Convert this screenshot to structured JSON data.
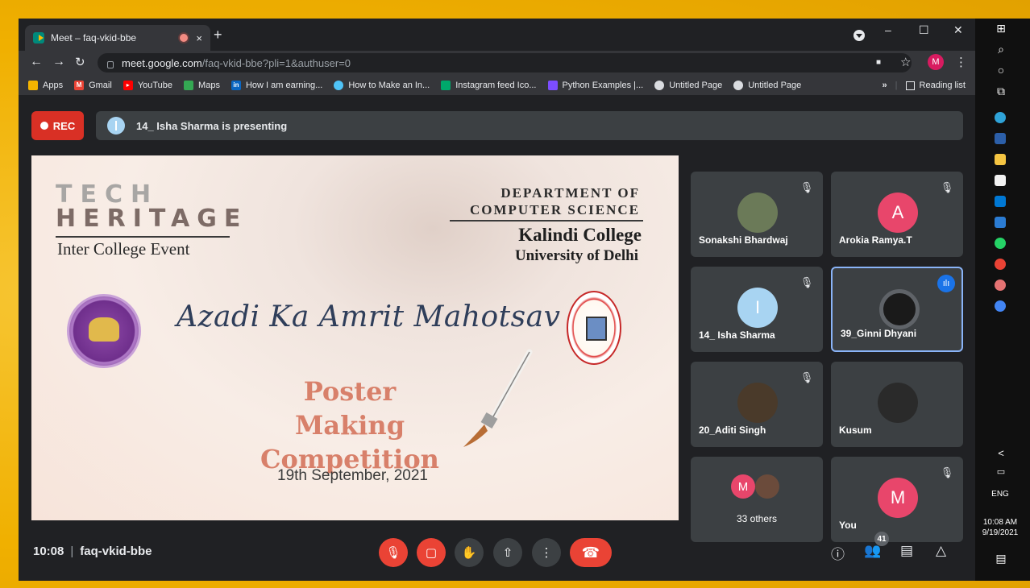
{
  "browser": {
    "tab_title": "Meet – faq-vkid-bbe",
    "tab_close": "×",
    "new_tab": "+",
    "window_controls": [
      "–",
      "☐",
      "✕"
    ],
    "url_host": "meet.google.com",
    "url_path": "/faq-vkid-bbe?pli=1&authuser=0",
    "profile_initial": "M",
    "bookmarks": [
      {
        "label": "Apps",
        "icon": "apps-grid-icon",
        "color": "#f4b400"
      },
      {
        "label": "Gmail",
        "icon": "gmail-icon",
        "color": "#ea4335"
      },
      {
        "label": "YouTube",
        "icon": "youtube-icon",
        "color": "#ff0000"
      },
      {
        "label": "Maps",
        "icon": "maps-icon",
        "color": "#34a853"
      },
      {
        "label": "How I am earning...",
        "icon": "linkedin-icon",
        "color": "#0a66c2"
      },
      {
        "label": "How to Make an In...",
        "icon": "site-icon",
        "color": "#4fc3f7"
      },
      {
        "label": "Instagram feed Ico...",
        "icon": "site-icon",
        "color": "#00a86b"
      },
      {
        "label": "Python Examples |...",
        "icon": "python-icon",
        "color": "#7c4dff"
      },
      {
        "label": "Untitled Page",
        "icon": "globe-icon",
        "color": "#9aa0a6"
      },
      {
        "label": "Untitled Page",
        "icon": "globe-icon",
        "color": "#9aa0a6"
      }
    ],
    "more_bookmarks": "»",
    "reading_list": "Reading list"
  },
  "meet": {
    "rec_label": "REC",
    "presenting_text": "14_ Isha Sharma is presenting",
    "slide": {
      "tech": "TECH",
      "heritage": "HERITAGE",
      "inter": "Inter College Event",
      "dept_line1": "DEPARTMENT OF",
      "dept_line2": "COMPUTER SCIENCE",
      "college": "Kalindi College",
      "university": "University of Delhi",
      "headline": "Azadi Ka Amrit Mahotsav",
      "poster_line1": "Poster Making",
      "poster_line2": "Competition",
      "date": "19th September, 2021"
    },
    "tiles": [
      {
        "name": "Sonakshi Bhardwaj",
        "muted": true,
        "avatar": "photo"
      },
      {
        "name": "Arokia Ramya.T",
        "muted": true,
        "avatar": "A",
        "color": "#e8466b"
      },
      {
        "name": "14_ Isha Sharma",
        "muted": true,
        "avatar": "I",
        "color": "#a8d4f2"
      },
      {
        "name": "39_Ginni Dhyani",
        "muted": false,
        "speaking": true,
        "avatar": "photo"
      },
      {
        "name": "20_Aditi Singh",
        "muted": true,
        "avatar": "photo"
      },
      {
        "name": "Kusum",
        "muted": false,
        "avatar": "photo"
      },
      {
        "name": "33 others",
        "muted": false,
        "avatar": "M"
      },
      {
        "name": "You",
        "muted": true,
        "avatar": "M",
        "color": "#e8466b"
      }
    ],
    "time": "10:08",
    "separator": "|",
    "meeting_code": "faq-vkid-bbe",
    "participant_count": "41",
    "accent_red": "#ea4335"
  },
  "taskbar": {
    "lang": "ENG",
    "time": "10:08 AM",
    "date": "9/19/2021",
    "chevron": "<"
  }
}
